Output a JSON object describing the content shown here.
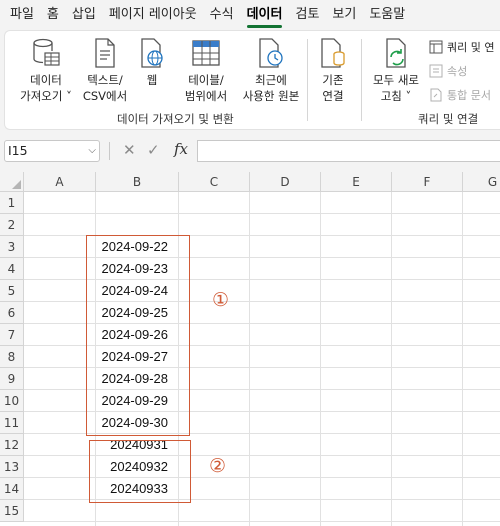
{
  "menu": {
    "tabs": [
      "파일",
      "홈",
      "삽입",
      "페이지 레이아웃",
      "수식",
      "데이터",
      "검토",
      "보기",
      "도움말"
    ],
    "active": "데이터"
  },
  "ribbon": {
    "get_data": {
      "line1": "데이터",
      "line2": "가져오기 ˅"
    },
    "text_csv": {
      "line1": "텍스트/",
      "line2": "CSV에서"
    },
    "web": {
      "line1": "웹"
    },
    "table_range": {
      "line1": "테이블/",
      "line2": "범위에서"
    },
    "recent": {
      "line1": "최근에",
      "line2": "사용한 원본"
    },
    "existing": {
      "line1": "기존",
      "line2": "연결"
    },
    "group1_label": "데이터 가져오기 및 변환",
    "refresh_all": {
      "line1": "모두 새로",
      "line2": "고침 ˅"
    },
    "queries_conn": "쿼리 및 연",
    "properties": "속성",
    "edit_links": "통합 문서",
    "group2_label": "쿼리 및 연결"
  },
  "formula_bar": {
    "name_box": "I15",
    "fx": "fx",
    "value": ""
  },
  "sheet": {
    "columns": [
      "A",
      "B",
      "C",
      "D",
      "E",
      "F",
      "G"
    ],
    "rows": [
      "1",
      "2",
      "3",
      "4",
      "5",
      "6",
      "7",
      "8",
      "9",
      "10",
      "11",
      "12",
      "13",
      "14",
      "15"
    ],
    "cells_b": [
      "",
      "",
      "2024-09-22",
      "2024-09-23",
      "2024-09-24",
      "2024-09-25",
      "2024-09-26",
      "2024-09-27",
      "2024-09-28",
      "2024-09-29",
      "2024-09-30",
      "20240931",
      "20240932",
      "20240933",
      ""
    ],
    "marker1": "①",
    "marker2": "②"
  },
  "colors": {
    "accent": "#137333",
    "annotation": "#d05a36"
  }
}
